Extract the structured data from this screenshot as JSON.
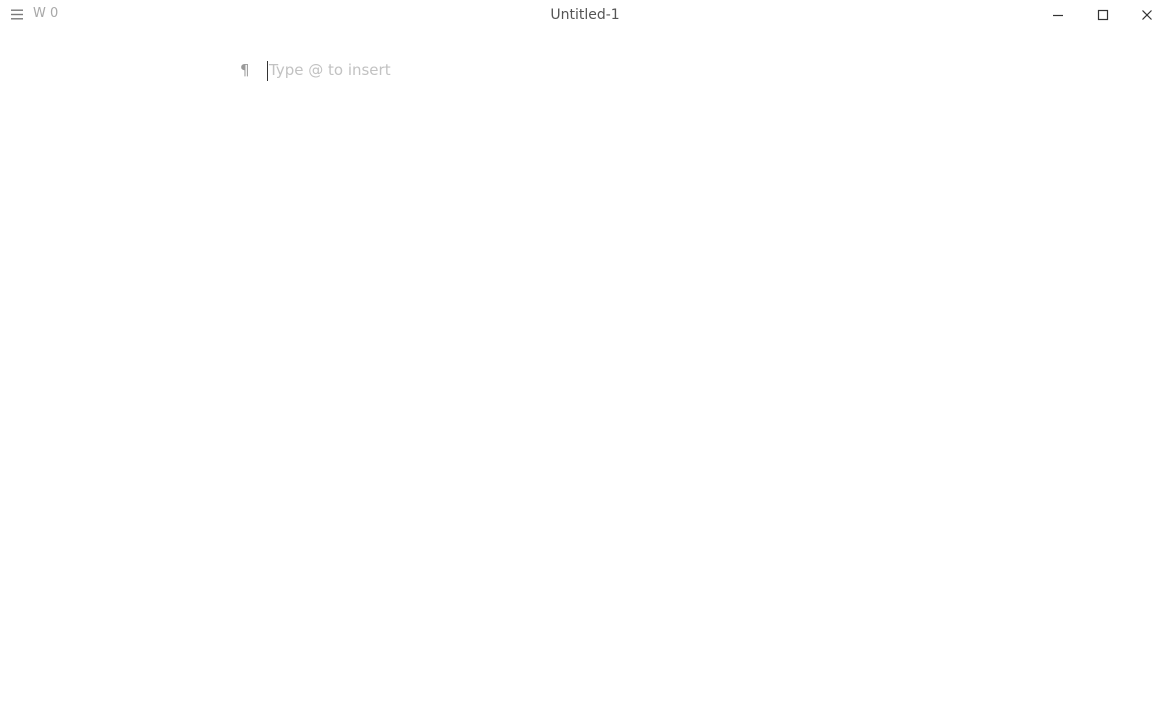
{
  "titlebar": {
    "menu_icon": "hamburger-menu-icon",
    "word_count": "W 0",
    "title": "Untitled-1",
    "controls": {
      "minimize_icon": "minimize-icon",
      "maximize_icon": "maximize-icon",
      "close_icon": "close-icon"
    }
  },
  "editor": {
    "paragraph_icon": "paragraph-mark-icon",
    "paragraph_glyph": "¶",
    "placeholder": "Type @ to insert"
  }
}
